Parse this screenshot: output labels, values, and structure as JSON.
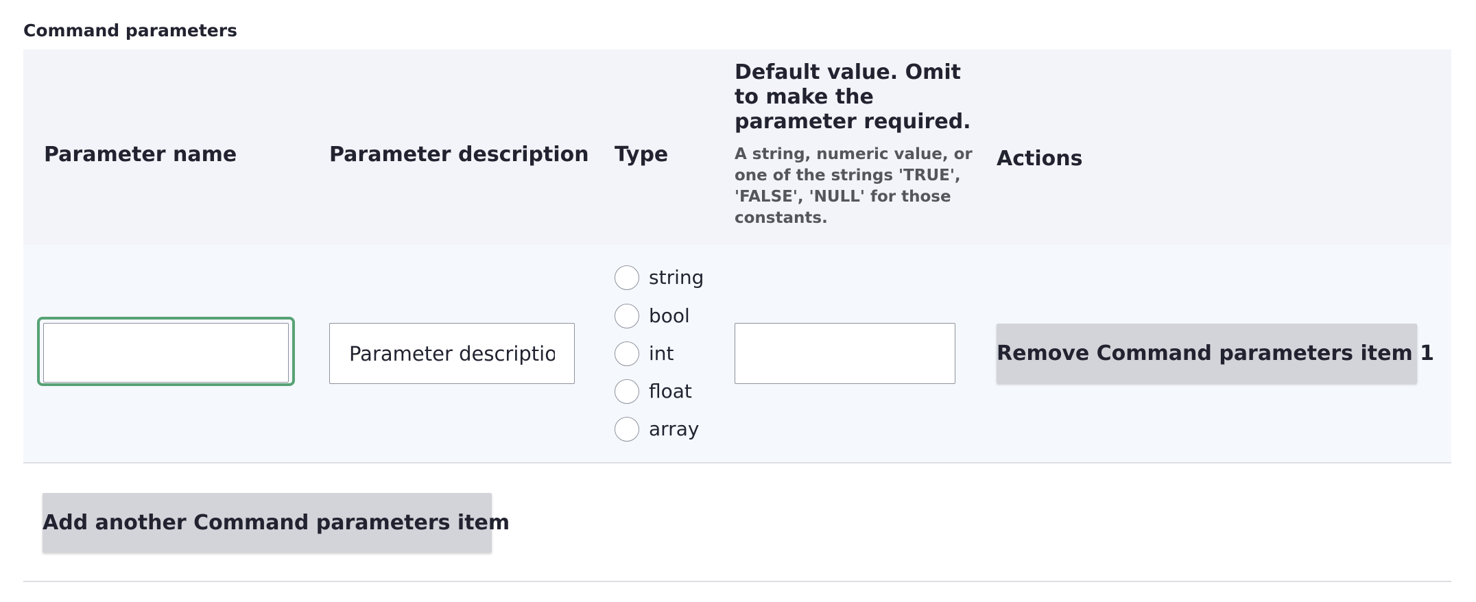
{
  "section": {
    "title": "Command parameters"
  },
  "table": {
    "headers": {
      "name": "Parameter name",
      "description": "Parameter description",
      "type": "Type",
      "default_main": "Default value. Omit to make the parameter required.",
      "default_help": "A string, numeric value, or one of the strings 'TRUE', 'FALSE', 'NULL' for those constants.",
      "actions": "Actions"
    },
    "row": {
      "name_value": "",
      "description_placeholder": "Parameter description.",
      "default_value": "",
      "type_options": [
        "string",
        "bool",
        "int",
        "float",
        "array"
      ],
      "remove_label": "Remove Command parameters item 1"
    }
  },
  "add_button_label": "Add another Command parameters item",
  "colors": {
    "focus_ring": "#57a275",
    "header_bg": "#f3f4f9",
    "row_bg": "#f5f8fd",
    "button_bg": "#d3d4d9"
  }
}
